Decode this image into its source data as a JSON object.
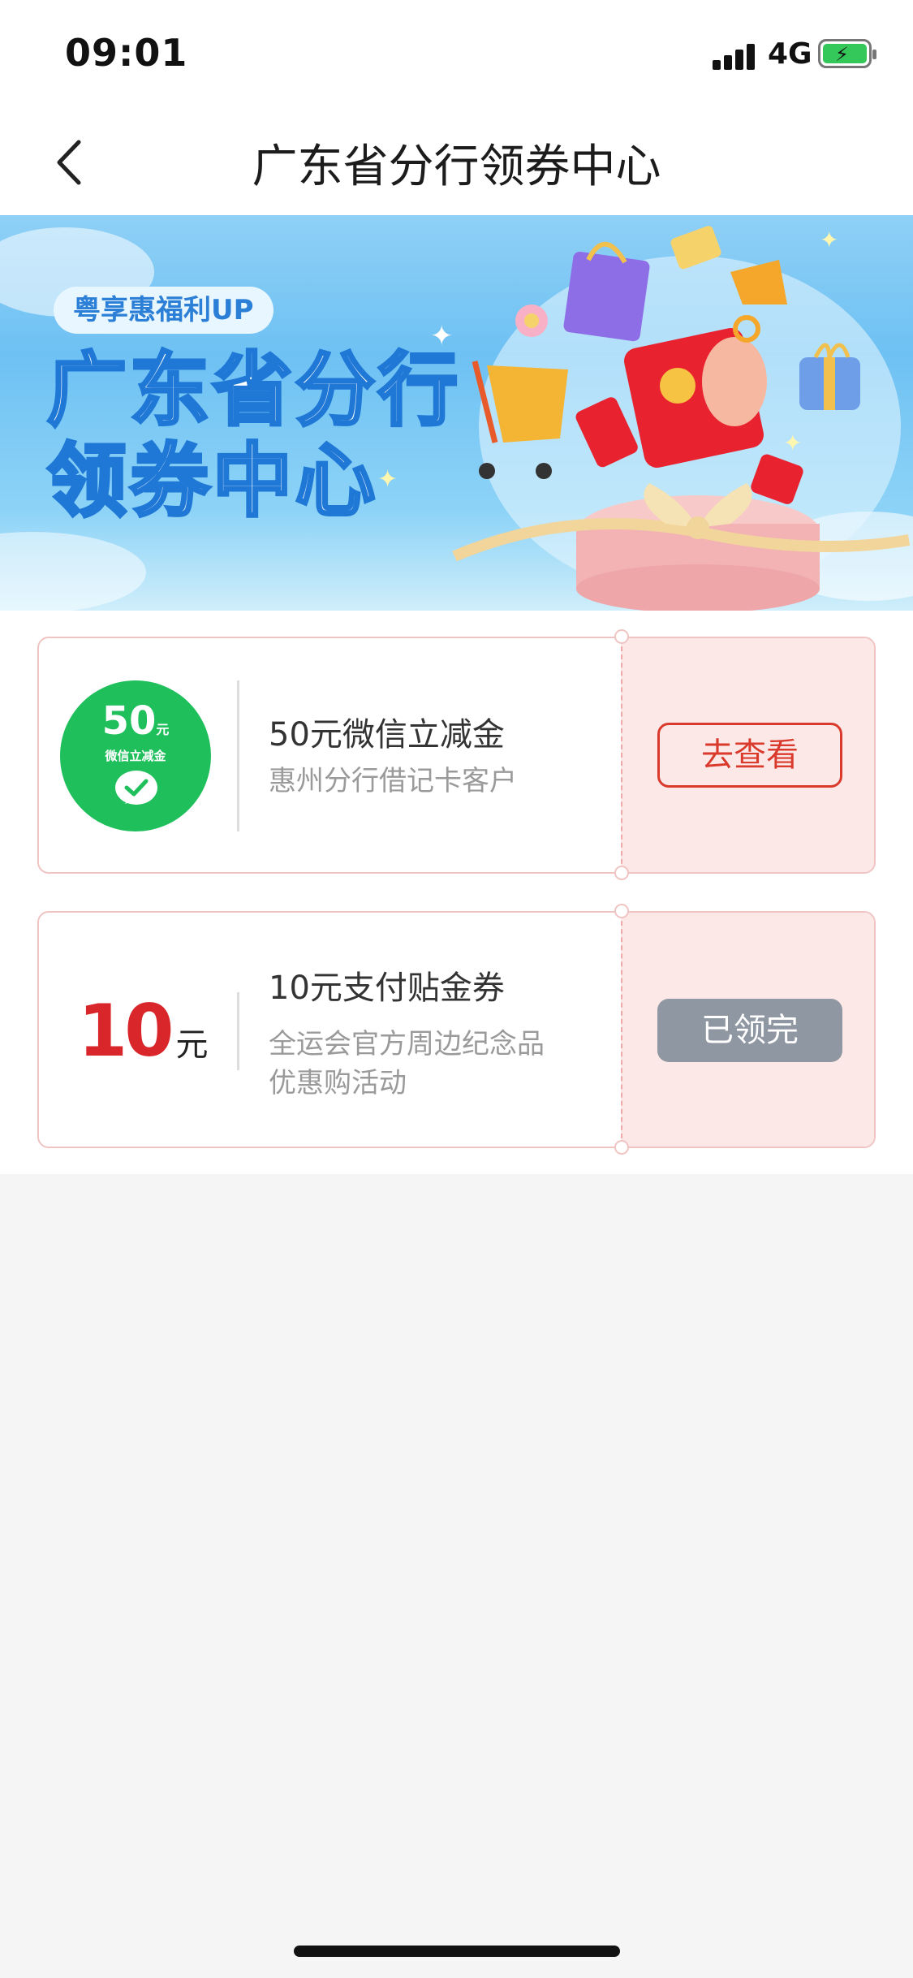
{
  "status_bar": {
    "time": "09:01",
    "network": "4G"
  },
  "nav": {
    "title": "广东省分行领券中心"
  },
  "banner": {
    "tag": "粤享惠福利UP",
    "title_line1": "广东省分行",
    "title_line2": "领券中心"
  },
  "coupons": [
    {
      "badge_amount": "50",
      "badge_unit": "元",
      "badge_label": "微信立减金",
      "title": "50元微信立减金",
      "desc_line1": "惠州分行借记卡客户",
      "action_label": "去查看",
      "action_state": "available"
    },
    {
      "amount": "10",
      "unit": "元",
      "title": "10元支付贴金券",
      "desc_line1": "全运会官方周边纪念品",
      "desc_line2": "优惠购活动",
      "action_label": "已领完",
      "action_state": "exhausted"
    }
  ],
  "colors": {
    "accent_red": "#d93a2c",
    "wechat_green": "#1fbf5c",
    "disabled_gray": "#8f97a3",
    "coupon_pink": "#fde8e8"
  }
}
